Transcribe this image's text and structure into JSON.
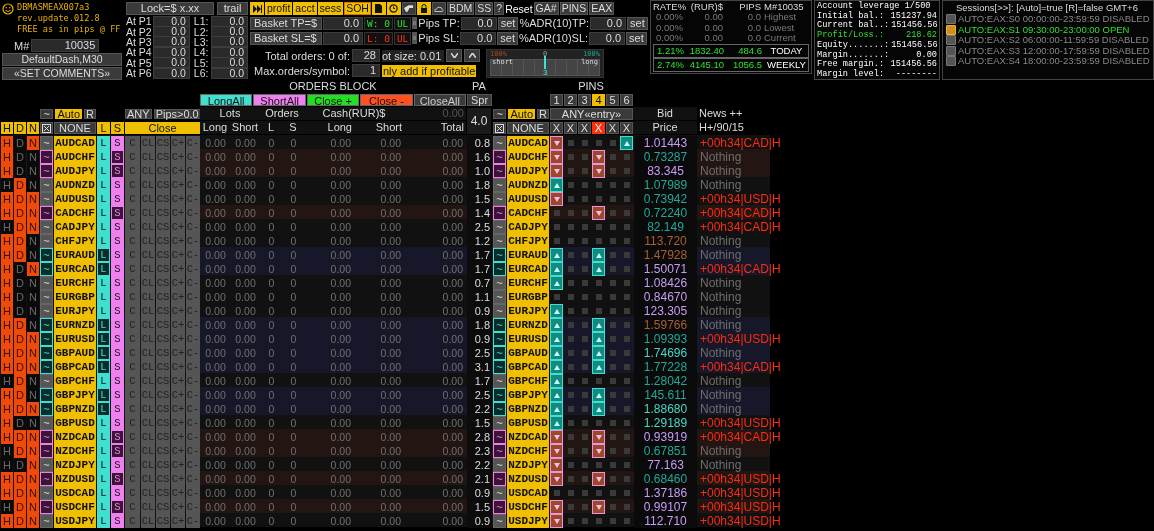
{
  "brand": {
    "title": "DBMASMEAX007a3",
    "version": "rev.update.012.8",
    "tagline": "FREE as in pips @ FF",
    "magic_label": "M#",
    "magic_value": "10035",
    "template_button": "DefaultDash,M30",
    "comments_button": "«SET COMMENTS»"
  },
  "lock": {
    "button": "Lock=$ x.xx",
    "trail": "trail",
    "profit_levels": [
      {
        "label": "At P1",
        "value": "0.0"
      },
      {
        "label": "At P2",
        "value": "0.0"
      },
      {
        "label": "At P3",
        "value": "0.0"
      },
      {
        "label": "At P4",
        "value": "0.0"
      },
      {
        "label": "At P5",
        "value": "0.0"
      },
      {
        "label": "At P6",
        "value": "0.0"
      }
    ],
    "loss_levels": [
      {
        "label": "L1:",
        "value": "0.0"
      },
      {
        "label": "L2:",
        "value": "0.0"
      },
      {
        "label": "L3:",
        "value": "0.0"
      },
      {
        "label": "L4:",
        "value": "0.0"
      },
      {
        "label": "L5:",
        "value": "0.0"
      },
      {
        "label": "L6:",
        "value": "0.0"
      }
    ]
  },
  "toolbar": {
    "primary": [
      "profit",
      "acct",
      "sess",
      "SOH"
    ],
    "secondary": [
      "BDM",
      "SS",
      "?"
    ],
    "reset": "Reset",
    "tertiary": [
      "GA#",
      "PINS",
      "EAX"
    ]
  },
  "basket": [
    {
      "label": "Basket TP=$",
      "value": "0.0",
      "counter": "W: 0",
      "counter_flag": "UL",
      "kind": "win",
      "pips_label": "Pips TP:",
      "pips_value": "0.0",
      "pips_button": "set",
      "adr_label": "%ADR(10)TP:",
      "adr_value": "0.0",
      "adr_button": "set"
    },
    {
      "label": "Basket SL=$",
      "value": "0.0",
      "counter": "L: 0",
      "counter_flag": "UL",
      "kind": "loss",
      "pips_label": "Pips SL:",
      "pips_value": "0.0",
      "pips_button": "set",
      "adr_label": "%ADR(10)SL:",
      "adr_value": "0.0",
      "adr_button": "set"
    }
  ],
  "orders": {
    "total_label": "Total orders: 0 of:",
    "total_value": "28",
    "lot_label": "ot size: 0.01",
    "max_label": "Max.orders/symbol:",
    "max_value": "1",
    "profitable_label": "nly add if profitable"
  },
  "slider": {
    "left_label": "100%",
    "center_label": "0",
    "right_label": "100%",
    "short_label": "short",
    "long_label": "long",
    "marker": "3",
    "level": 0.5
  },
  "stats": {
    "headers": [
      "RATE%",
      "(RUR)$",
      "PIPS",
      "M#10035"
    ],
    "rows": [
      {
        "rate": "0.00%",
        "cash": "0.00",
        "pips": "0.0",
        "label": "Highest",
        "active": false
      },
      {
        "rate": "0.00%",
        "cash": "0.00",
        "pips": "0.0",
        "label": "Lowest",
        "active": false
      },
      {
        "rate": "0.00%",
        "cash": "0.00",
        "pips": "0.0",
        "label": "Current",
        "active": false
      },
      {
        "rate": "1.21%",
        "cash": "1832.40",
        "pips": "484.6",
        "label": "TODAY",
        "active": true
      },
      {
        "rate": "2.74%",
        "cash": "4145.10",
        "pips": "1056.5",
        "label": "WEEKLY",
        "active": true
      }
    ]
  },
  "account": {
    "leverage": "Account leverage 1/500",
    "lines": [
      {
        "label": "Initial bal.:",
        "value": "151237.94",
        "positive": false
      },
      {
        "label": "Current bal..:",
        "value": "151456.56",
        "positive": false
      },
      {
        "label": "Profit/Loss.:",
        "value": "218.62",
        "positive": true
      },
      {
        "label": "Equity.......:",
        "value": "151456.56",
        "positive": false
      },
      {
        "label": "Margin.......:",
        "value": "0.00",
        "positive": false
      },
      {
        "label": "Free margin.:",
        "value": "151456.56",
        "positive": false
      },
      {
        "label": "Margin level:",
        "value": "--------",
        "positive": false
      }
    ]
  },
  "sessions": {
    "title": "Sessions[>>]: [Auto]=true [R]=false GMT+6",
    "items": [
      {
        "text": "AUTO:EAX:S0 00:00:00-23:59:59 DISABLED",
        "open": false
      },
      {
        "text": "AUTO:EAX:S1 09:30:00-23:00:00 OPEN",
        "open": true
      },
      {
        "text": "AUTO:EAX:S2 06:00:00-11:59:59 DISABLED",
        "open": false
      },
      {
        "text": "AUTO:EAX:S3 12:00:00-17:59:59 DISABLED",
        "open": false
      },
      {
        "text": "AUTO:EAX:S4 18:00:00-23:59:59 DISABLED",
        "open": false
      }
    ]
  },
  "table": {
    "orders_block_title": "ORDERS BLOCK",
    "pa_title": "PA",
    "pins_title": "PINS",
    "actions": [
      {
        "label": "LongAll",
        "kind": "long"
      },
      {
        "label": "ShortAll",
        "kind": "short"
      },
      {
        "label": "Close +",
        "kind": "profit"
      },
      {
        "label": "Close -",
        "kind": "loss"
      },
      {
        "label": "CloseAll",
        "kind": "all"
      }
    ],
    "spread_button": "Spr",
    "pa_value": "4.0",
    "left_controls": {
      "trend": "~",
      "auto": "Auto",
      "auto_on": true,
      "reset": "R"
    },
    "filter_any": "ANY",
    "filter_pips": "Pips>0.0",
    "col_lots": "Lots",
    "col_orders": "Orders",
    "col_cash": "Cash(RUR)$",
    "cash_total": "0.00",
    "right_controls": {
      "trend": "~",
      "auto": "Auto",
      "auto_on": true,
      "reset": "R"
    },
    "pins_entry": "ANY«entry»",
    "col_bid": "Bid",
    "col_news": "News ++",
    "flag_heads": [
      "H",
      "D",
      "N"
    ],
    "select_none": "NONE",
    "side_heads": [
      "L",
      "S"
    ],
    "close_head": "Close",
    "subheads": [
      "Long",
      "Short",
      "L",
      "S",
      "Long",
      "Short",
      "Total"
    ],
    "right_none": "NONE",
    "pin_tabs": [
      {
        "label": "1",
        "selected": false
      },
      {
        "label": "2",
        "selected": false
      },
      {
        "label": "3",
        "selected": false
      },
      {
        "label": "4",
        "selected": true
      },
      {
        "label": "5",
        "selected": false
      },
      {
        "label": "6",
        "selected": false
      }
    ],
    "pin_clear": [
      {
        "label": "X",
        "selected": false
      },
      {
        "label": "X",
        "selected": false
      },
      {
        "label": "X",
        "selected": false
      },
      {
        "label": "X",
        "selected": true
      },
      {
        "label": "X",
        "selected": false
      },
      {
        "label": "X",
        "selected": false
      }
    ],
    "col_price": "Price",
    "news_filter": "H+/90/15"
  },
  "rows": [
    {
      "flags": [
        {
          "label": "H",
          "on": true
        },
        {
          "label": "D",
          "on": false
        },
        {
          "label": "N",
          "on": true
        }
      ],
      "trend": "~",
      "kind": "flat",
      "symbol": "AUDCAD",
      "buttons": [
        "L",
        "S",
        "C",
        "CL",
        "CS",
        "C+",
        "C-"
      ],
      "values": [
        "0.00",
        "0.00",
        "0",
        "0",
        "0.00",
        "0.00",
        "0.00"
      ],
      "pa": "0.8",
      "trend_right": "~",
      "symbol_right": "AUDCAD",
      "pins": [
        {
          "kind": "down"
        },
        {
          "kind": "empty"
        },
        {
          "kind": "empty"
        },
        {
          "kind": "empty"
        },
        {
          "kind": "empty"
        },
        {
          "kind": "up"
        }
      ],
      "bid": "1.01443",
      "color": "#c89cf8",
      "news": "+00h34|CAD|H",
      "news_alert": true
    },
    {
      "flags": [
        {
          "label": "H",
          "on": true
        },
        {
          "label": "D",
          "on": false
        },
        {
          "label": "N",
          "on": false
        }
      ],
      "trend": "~",
      "kind": "short",
      "symbol": "AUDCHF",
      "buttons": [
        "L",
        "S",
        "C",
        "CL",
        "CS",
        "C+",
        "C-"
      ],
      "values": [
        "0.00",
        "0.00",
        "0",
        "0",
        "0.00",
        "0.00",
        "0.00"
      ],
      "pa": "1.6",
      "trend_right": "~",
      "symbol_right": "AUDCHF",
      "pins": [
        {
          "kind": "down"
        },
        {
          "kind": "empty"
        },
        {
          "kind": "empty"
        },
        {
          "kind": "down"
        },
        {
          "kind": "empty"
        },
        {
          "kind": "empty"
        }
      ],
      "bid": "0.73287",
      "color": "#22a89a",
      "news": "Nothing",
      "news_alert": false
    },
    {
      "flags": [
        {
          "label": "H",
          "on": true
        },
        {
          "label": "D",
          "on": false
        },
        {
          "label": "N",
          "on": false
        }
      ],
      "trend": "~",
      "kind": "short",
      "symbol": "AUDJPY",
      "buttons": [
        "L",
        "S",
        "C",
        "CL",
        "CS",
        "C+",
        "C-"
      ],
      "values": [
        "0.00",
        "0.00",
        "0",
        "0",
        "0.00",
        "0.00",
        "0.00"
      ],
      "pa": "1.0",
      "trend_right": "~",
      "symbol_right": "AUDJPY",
      "pins": [
        {
          "kind": "down"
        },
        {
          "kind": "empty"
        },
        {
          "kind": "empty"
        },
        {
          "kind": "down"
        },
        {
          "kind": "empty"
        },
        {
          "kind": "empty"
        }
      ],
      "bid": "83.345",
      "color": "#c89cf8",
      "news": "Nothing",
      "news_alert": false
    },
    {
      "flags": [
        {
          "label": "H",
          "on": false
        },
        {
          "label": "D",
          "on": true
        },
        {
          "label": "N",
          "on": false
        }
      ],
      "trend": "~",
      "kind": "flat",
      "symbol": "AUDNZD",
      "buttons": [
        "L",
        "S",
        "C",
        "CL",
        "CS",
        "C+",
        "C-"
      ],
      "values": [
        "0.00",
        "0.00",
        "0",
        "0",
        "0.00",
        "0.00",
        "0.00"
      ],
      "pa": "1.8",
      "trend_right": "~",
      "symbol_right": "AUDNZD",
      "pins": [
        {
          "kind": "up"
        },
        {
          "kind": "empty"
        },
        {
          "kind": "empty"
        },
        {
          "kind": "empty"
        },
        {
          "kind": "empty"
        },
        {
          "kind": "empty"
        }
      ],
      "bid": "1.07989",
      "color": "#22a89a",
      "news": "Nothing",
      "news_alert": false
    },
    {
      "flags": [
        {
          "label": "H",
          "on": true
        },
        {
          "label": "D",
          "on": true
        },
        {
          "label": "N",
          "on": true
        }
      ],
      "trend": "~",
      "kind": "flat",
      "symbol": "AUDUSD",
      "buttons": [
        "L",
        "S",
        "C",
        "CL",
        "CS",
        "C+",
        "C-"
      ],
      "values": [
        "0.00",
        "0.00",
        "0",
        "0",
        "0.00",
        "0.00",
        "0.00"
      ],
      "pa": "1.5",
      "trend_right": "~",
      "symbol_right": "AUDUSD",
      "pins": [
        {
          "kind": "down"
        },
        {
          "kind": "empty"
        },
        {
          "kind": "empty"
        },
        {
          "kind": "empty"
        },
        {
          "kind": "empty"
        },
        {
          "kind": "empty"
        }
      ],
      "bid": "0.73942",
      "color": "#22a89a",
      "news": "+00h34|USD|H",
      "news_alert": true
    },
    {
      "flags": [
        {
          "label": "H",
          "on": true
        },
        {
          "label": "D",
          "on": true
        },
        {
          "label": "N",
          "on": true
        }
      ],
      "trend": "~",
      "kind": "short",
      "symbol": "CADCHF",
      "buttons": [
        "L",
        "S",
        "C",
        "CL",
        "CS",
        "C+",
        "C-"
      ],
      "values": [
        "0.00",
        "0.00",
        "0",
        "0",
        "0.00",
        "0.00",
        "0.00"
      ],
      "pa": "1.4",
      "trend_right": "~",
      "symbol_right": "CADCHF",
      "pins": [
        {
          "kind": "empty"
        },
        {
          "kind": "empty"
        },
        {
          "kind": "empty"
        },
        {
          "kind": "down"
        },
        {
          "kind": "empty"
        },
        {
          "kind": "empty"
        }
      ],
      "bid": "0.72240",
      "color": "#22a89a",
      "news": "+00h34|CAD|H",
      "news_alert": true
    },
    {
      "flags": [
        {
          "label": "H",
          "on": false
        },
        {
          "label": "D",
          "on": true
        },
        {
          "label": "N",
          "on": true
        }
      ],
      "trend": "~",
      "kind": "flat",
      "symbol": "CADJPY",
      "buttons": [
        "L",
        "S",
        "C",
        "CL",
        "CS",
        "C+",
        "C-"
      ],
      "values": [
        "0.00",
        "0.00",
        "0",
        "0",
        "0.00",
        "0.00",
        "0.00"
      ],
      "pa": "2.5",
      "trend_right": "~",
      "symbol_right": "CADJPY",
      "pins": [
        {
          "kind": "empty"
        },
        {
          "kind": "empty"
        },
        {
          "kind": "empty"
        },
        {
          "kind": "empty"
        },
        {
          "kind": "empty"
        },
        {
          "kind": "empty"
        }
      ],
      "bid": "82.149",
      "color": "#22a89a",
      "news": "+00h34|CAD|H",
      "news_alert": true
    },
    {
      "flags": [
        {
          "label": "H",
          "on": true
        },
        {
          "label": "D",
          "on": true
        },
        {
          "label": "N",
          "on": false
        }
      ],
      "trend": "~",
      "kind": "flat",
      "symbol": "CHFJPY",
      "buttons": [
        "L",
        "S",
        "C",
        "CL",
        "CS",
        "C+",
        "C-"
      ],
      "values": [
        "0.00",
        "0.00",
        "0",
        "0",
        "0.00",
        "0.00",
        "0.00"
      ],
      "pa": "1.2",
      "trend_right": "~",
      "symbol_right": "CHFJPY",
      "pins": [
        {
          "kind": "empty"
        },
        {
          "kind": "empty"
        },
        {
          "kind": "empty"
        },
        {
          "kind": "empty"
        },
        {
          "kind": "empty"
        },
        {
          "kind": "empty"
        }
      ],
      "bid": "113.720",
      "color": "#a86030",
      "news": "Nothing",
      "news_alert": false
    },
    {
      "flags": [
        {
          "label": "H",
          "on": true
        },
        {
          "label": "D",
          "on": true
        },
        {
          "label": "N",
          "on": false
        }
      ],
      "trend": "~",
      "kind": "long",
      "symbol": "EURAUD",
      "buttons": [
        "L",
        "S",
        "C",
        "CL",
        "CS",
        "C+",
        "C-"
      ],
      "values": [
        "0.00",
        "0.00",
        "0",
        "0",
        "0.00",
        "0.00",
        "0.00"
      ],
      "pa": "1.7",
      "trend_right": "~",
      "symbol_right": "EURAUD",
      "pins": [
        {
          "kind": "up"
        },
        {
          "kind": "empty"
        },
        {
          "kind": "empty"
        },
        {
          "kind": "up"
        },
        {
          "kind": "empty"
        },
        {
          "kind": "empty"
        }
      ],
      "bid": "1.47928",
      "color": "#a86030",
      "news": "Nothing",
      "news_alert": false
    },
    {
      "flags": [
        {
          "label": "H",
          "on": true
        },
        {
          "label": "D",
          "on": false
        },
        {
          "label": "N",
          "on": true
        }
      ],
      "trend": "~",
      "kind": "long",
      "symbol": "EURCAD",
      "buttons": [
        "L",
        "S",
        "C",
        "CL",
        "CS",
        "C+",
        "C-"
      ],
      "values": [
        "0.00",
        "0.00",
        "0",
        "0",
        "0.00",
        "0.00",
        "0.00"
      ],
      "pa": "1.7",
      "trend_right": "~",
      "symbol_right": "EURCAD",
      "pins": [
        {
          "kind": "up"
        },
        {
          "kind": "empty"
        },
        {
          "kind": "empty"
        },
        {
          "kind": "up"
        },
        {
          "kind": "empty"
        },
        {
          "kind": "empty"
        }
      ],
      "bid": "1.50071",
      "color": "#c89cf8",
      "news": "+00h34|CAD|H",
      "news_alert": true
    },
    {
      "flags": [
        {
          "label": "H",
          "on": true
        },
        {
          "label": "D",
          "on": false
        },
        {
          "label": "N",
          "on": false
        }
      ],
      "trend": "~",
      "kind": "flat",
      "symbol": "EURCHF",
      "buttons": [
        "L",
        "S",
        "C",
        "CL",
        "CS",
        "C+",
        "C-"
      ],
      "values": [
        "0.00",
        "0.00",
        "0",
        "0",
        "0.00",
        "0.00",
        "0.00"
      ],
      "pa": "0.7",
      "trend_right": "~",
      "symbol_right": "EURCHF",
      "pins": [
        {
          "kind": "up"
        },
        {
          "kind": "empty"
        },
        {
          "kind": "empty"
        },
        {
          "kind": "empty"
        },
        {
          "kind": "empty"
        },
        {
          "kind": "empty"
        }
      ],
      "bid": "1.08426",
      "color": "#c89cf8",
      "news": "Nothing",
      "news_alert": false
    },
    {
      "flags": [
        {
          "label": "H",
          "on": true
        },
        {
          "label": "D",
          "on": false
        },
        {
          "label": "N",
          "on": false
        }
      ],
      "trend": "~",
      "kind": "flat",
      "symbol": "EURGBP",
      "buttons": [
        "L",
        "S",
        "C",
        "CL",
        "CS",
        "C+",
        "C-"
      ],
      "values": [
        "0.00",
        "0.00",
        "0",
        "0",
        "0.00",
        "0.00",
        "0.00"
      ],
      "pa": "1.1",
      "trend_right": "~",
      "symbol_right": "EURGBP",
      "pins": [
        {
          "kind": "empty"
        },
        {
          "kind": "empty"
        },
        {
          "kind": "empty"
        },
        {
          "kind": "empty"
        },
        {
          "kind": "empty"
        },
        {
          "kind": "empty"
        }
      ],
      "bid": "0.84670",
      "color": "#c89cf8",
      "news": "Nothing",
      "news_alert": false
    },
    {
      "flags": [
        {
          "label": "H",
          "on": true
        },
        {
          "label": "D",
          "on": false
        },
        {
          "label": "N",
          "on": false
        }
      ],
      "trend": "~",
      "kind": "flat",
      "symbol": "EURJPY",
      "buttons": [
        "L",
        "S",
        "C",
        "CL",
        "CS",
        "C+",
        "C-"
      ],
      "values": [
        "0.00",
        "0.00",
        "0",
        "0",
        "0.00",
        "0.00",
        "0.00"
      ],
      "pa": "0.9",
      "trend_right": "~",
      "symbol_right": "EURJPY",
      "pins": [
        {
          "kind": "up"
        },
        {
          "kind": "empty"
        },
        {
          "kind": "empty"
        },
        {
          "kind": "empty"
        },
        {
          "kind": "empty"
        },
        {
          "kind": "empty"
        }
      ],
      "bid": "123.305",
      "color": "#c89cf8",
      "news": "Nothing",
      "news_alert": false
    },
    {
      "flags": [
        {
          "label": "H",
          "on": true
        },
        {
          "label": "D",
          "on": true
        },
        {
          "label": "N",
          "on": false
        }
      ],
      "trend": "~",
      "kind": "long",
      "symbol": "EURNZD",
      "buttons": [
        "L",
        "S",
        "C",
        "CL",
        "CS",
        "C+",
        "C-"
      ],
      "values": [
        "0.00",
        "0.00",
        "0",
        "0",
        "0.00",
        "0.00",
        "0.00"
      ],
      "pa": "1.8",
      "trend_right": "~",
      "symbol_right": "EURNZD",
      "pins": [
        {
          "kind": "up"
        },
        {
          "kind": "empty"
        },
        {
          "kind": "empty"
        },
        {
          "kind": "up"
        },
        {
          "kind": "empty"
        },
        {
          "kind": "empty"
        }
      ],
      "bid": "1.59766",
      "color": "#a86030",
      "news": "Nothing",
      "news_alert": false
    },
    {
      "flags": [
        {
          "label": "H",
          "on": true
        },
        {
          "label": "D",
          "on": true
        },
        {
          "label": "N",
          "on": true
        }
      ],
      "trend": "~",
      "kind": "long",
      "symbol": "EURUSD",
      "buttons": [
        "L",
        "S",
        "C",
        "CL",
        "CS",
        "C+",
        "C-"
      ],
      "values": [
        "0.00",
        "0.00",
        "0",
        "0",
        "0.00",
        "0.00",
        "0.00"
      ],
      "pa": "0.9",
      "trend_right": "~",
      "symbol_right": "EURUSD",
      "pins": [
        {
          "kind": "up"
        },
        {
          "kind": "empty"
        },
        {
          "kind": "empty"
        },
        {
          "kind": "up"
        },
        {
          "kind": "empty"
        },
        {
          "kind": "empty"
        }
      ],
      "bid": "1.09393",
      "color": "#22a89a",
      "news": "+00h34|USD|H",
      "news_alert": true
    },
    {
      "flags": [
        {
          "label": "H",
          "on": true
        },
        {
          "label": "D",
          "on": true
        },
        {
          "label": "N",
          "on": true
        }
      ],
      "trend": "~",
      "kind": "long",
      "symbol": "GBPAUD",
      "buttons": [
        "L",
        "S",
        "C",
        "CL",
        "CS",
        "C+",
        "C-"
      ],
      "values": [
        "0.00",
        "0.00",
        "0",
        "0",
        "0.00",
        "0.00",
        "0.00"
      ],
      "pa": "2.5",
      "trend_right": "~",
      "symbol_right": "GBPAUD",
      "pins": [
        {
          "kind": "up"
        },
        {
          "kind": "empty"
        },
        {
          "kind": "empty"
        },
        {
          "kind": "up"
        },
        {
          "kind": "empty"
        },
        {
          "kind": "empty"
        }
      ],
      "bid": "1.74696",
      "color": "#48d8c8",
      "news": "Nothing",
      "news_alert": false
    },
    {
      "flags": [
        {
          "label": "H",
          "on": true
        },
        {
          "label": "D",
          "on": true
        },
        {
          "label": "N",
          "on": true
        }
      ],
      "trend": "~",
      "kind": "long",
      "symbol": "GBPCAD",
      "buttons": [
        "L",
        "S",
        "C",
        "CL",
        "CS",
        "C+",
        "C-"
      ],
      "values": [
        "0.00",
        "0.00",
        "0",
        "0",
        "0.00",
        "0.00",
        "0.00"
      ],
      "pa": "3.1",
      "trend_right": "~",
      "symbol_right": "GBPCAD",
      "pins": [
        {
          "kind": "up"
        },
        {
          "kind": "empty"
        },
        {
          "kind": "empty"
        },
        {
          "kind": "up"
        },
        {
          "kind": "empty"
        },
        {
          "kind": "empty"
        }
      ],
      "bid": "1.77228",
      "color": "#22a89a",
      "news": "+00h34|CAD|H",
      "news_alert": true
    },
    {
      "flags": [
        {
          "label": "H",
          "on": false
        },
        {
          "label": "D",
          "on": true
        },
        {
          "label": "N",
          "on": false
        }
      ],
      "trend": "~",
      "kind": "flat",
      "symbol": "GBPCHF",
      "buttons": [
        "L",
        "S",
        "C",
        "CL",
        "CS",
        "C+",
        "C-"
      ],
      "values": [
        "0.00",
        "0.00",
        "0",
        "0",
        "0.00",
        "0.00",
        "0.00"
      ],
      "pa": "1.7",
      "trend_right": "~",
      "symbol_right": "GBPCHF",
      "pins": [
        {
          "kind": "up"
        },
        {
          "kind": "empty"
        },
        {
          "kind": "empty"
        },
        {
          "kind": "empty"
        },
        {
          "kind": "empty"
        },
        {
          "kind": "empty"
        }
      ],
      "bid": "1.28042",
      "color": "#22a89a",
      "news": "Nothing",
      "news_alert": false
    },
    {
      "flags": [
        {
          "label": "H",
          "on": true
        },
        {
          "label": "D",
          "on": true
        },
        {
          "label": "N",
          "on": false
        }
      ],
      "trend": "~",
      "kind": "long",
      "symbol": "GBPJPY",
      "buttons": [
        "L",
        "S",
        "C",
        "CL",
        "CS",
        "C+",
        "C-"
      ],
      "values": [
        "0.00",
        "0.00",
        "0",
        "0",
        "0.00",
        "0.00",
        "0.00"
      ],
      "pa": "2.5",
      "trend_right": "~",
      "symbol_right": "GBPJPY",
      "pins": [
        {
          "kind": "up"
        },
        {
          "kind": "empty"
        },
        {
          "kind": "empty"
        },
        {
          "kind": "up"
        },
        {
          "kind": "empty"
        },
        {
          "kind": "empty"
        }
      ],
      "bid": "145.611",
      "color": "#22a89a",
      "news": "Nothing",
      "news_alert": false
    },
    {
      "flags": [
        {
          "label": "H",
          "on": true
        },
        {
          "label": "D",
          "on": true
        },
        {
          "label": "N",
          "on": true
        }
      ],
      "trend": "~",
      "kind": "long",
      "symbol": "GBPNZD",
      "buttons": [
        "L",
        "S",
        "C",
        "CL",
        "CS",
        "C+",
        "C-"
      ],
      "values": [
        "0.00",
        "0.00",
        "0",
        "0",
        "0.00",
        "0.00",
        "0.00"
      ],
      "pa": "2.2",
      "trend_right": "~",
      "symbol_right": "GBPNZD",
      "pins": [
        {
          "kind": "up"
        },
        {
          "kind": "empty"
        },
        {
          "kind": "empty"
        },
        {
          "kind": "up"
        },
        {
          "kind": "empty"
        },
        {
          "kind": "empty"
        }
      ],
      "bid": "1.88680",
      "color": "#48d8c8",
      "news": "Nothing",
      "news_alert": false
    },
    {
      "flags": [
        {
          "label": "H",
          "on": true
        },
        {
          "label": "D",
          "on": false
        },
        {
          "label": "N",
          "on": false
        }
      ],
      "trend": "~",
      "kind": "flat",
      "symbol": "GBPUSD",
      "buttons": [
        "L",
        "S",
        "C",
        "CL",
        "CS",
        "C+",
        "C-"
      ],
      "values": [
        "0.00",
        "0.00",
        "0",
        "0",
        "0.00",
        "0.00",
        "0.00"
      ],
      "pa": "1.5",
      "trend_right": "~",
      "symbol_right": "GBPUSD",
      "pins": [
        {
          "kind": "up"
        },
        {
          "kind": "empty"
        },
        {
          "kind": "empty"
        },
        {
          "kind": "empty"
        },
        {
          "kind": "empty"
        },
        {
          "kind": "empty"
        }
      ],
      "bid": "1.29189",
      "color": "#48d8c8",
      "news": "+00h34|USD|H",
      "news_alert": true
    },
    {
      "flags": [
        {
          "label": "H",
          "on": true
        },
        {
          "label": "D",
          "on": true
        },
        {
          "label": "N",
          "on": true
        }
      ],
      "trend": "~",
      "kind": "short",
      "symbol": "NZDCAD",
      "buttons": [
        "L",
        "S",
        "C",
        "CL",
        "CS",
        "C+",
        "C-"
      ],
      "values": [
        "0.00",
        "0.00",
        "0",
        "0",
        "0.00",
        "0.00",
        "0.00"
      ],
      "pa": "2.8",
      "trend_right": "~",
      "symbol_right": "NZDCAD",
      "pins": [
        {
          "kind": "down"
        },
        {
          "kind": "empty"
        },
        {
          "kind": "empty"
        },
        {
          "kind": "down"
        },
        {
          "kind": "empty"
        },
        {
          "kind": "empty"
        }
      ],
      "bid": "0.93919",
      "color": "#c89cf8",
      "news": "+00h34|CAD|H",
      "news_alert": true
    },
    {
      "flags": [
        {
          "label": "H",
          "on": false
        },
        {
          "label": "D",
          "on": true
        },
        {
          "label": "N",
          "on": true
        }
      ],
      "trend": "~",
      "kind": "short",
      "symbol": "NZDCHF",
      "buttons": [
        "L",
        "S",
        "C",
        "CL",
        "CS",
        "C+",
        "C-"
      ],
      "values": [
        "0.00",
        "0.00",
        "0",
        "0",
        "0.00",
        "0.00",
        "0.00"
      ],
      "pa": "2.3",
      "trend_right": "~",
      "symbol_right": "NZDCHF",
      "pins": [
        {
          "kind": "down"
        },
        {
          "kind": "empty"
        },
        {
          "kind": "empty"
        },
        {
          "kind": "down"
        },
        {
          "kind": "empty"
        },
        {
          "kind": "empty"
        }
      ],
      "bid": "0.67851",
      "color": "#22a89a",
      "news": "Nothing",
      "news_alert": false
    },
    {
      "flags": [
        {
          "label": "H",
          "on": false
        },
        {
          "label": "D",
          "on": false
        },
        {
          "label": "N",
          "on": true
        }
      ],
      "trend": "~",
      "kind": "flat",
      "symbol": "NZDJPY",
      "buttons": [
        "L",
        "S",
        "C",
        "CL",
        "CS",
        "C+",
        "C-"
      ],
      "values": [
        "0.00",
        "0.00",
        "0",
        "0",
        "0.00",
        "0.00",
        "0.00"
      ],
      "pa": "2.2",
      "trend_right": "~",
      "symbol_right": "NZDJPY",
      "pins": [
        {
          "kind": "down"
        },
        {
          "kind": "empty"
        },
        {
          "kind": "empty"
        },
        {
          "kind": "empty"
        },
        {
          "kind": "empty"
        },
        {
          "kind": "empty"
        }
      ],
      "bid": "77.163",
      "color": "#c89cf8",
      "news": "Nothing",
      "news_alert": false
    },
    {
      "flags": [
        {
          "label": "H",
          "on": true
        },
        {
          "label": "D",
          "on": true
        },
        {
          "label": "N",
          "on": true
        }
      ],
      "trend": "~",
      "kind": "short",
      "symbol": "NZDUSD",
      "buttons": [
        "L",
        "S",
        "C",
        "CL",
        "CS",
        "C+",
        "C-"
      ],
      "values": [
        "0.00",
        "0.00",
        "0",
        "0",
        "0.00",
        "0.00",
        "0.00"
      ],
      "pa": "2.1",
      "trend_right": "~",
      "symbol_right": "NZDUSD",
      "pins": [
        {
          "kind": "down"
        },
        {
          "kind": "empty"
        },
        {
          "kind": "empty"
        },
        {
          "kind": "down"
        },
        {
          "kind": "empty"
        },
        {
          "kind": "empty"
        }
      ],
      "bid": "0.68460",
      "color": "#22a89a",
      "news": "+00h34|USD|H",
      "news_alert": true
    },
    {
      "flags": [
        {
          "label": "H",
          "on": true
        },
        {
          "label": "D",
          "on": true
        },
        {
          "label": "N",
          "on": true
        }
      ],
      "trend": "~",
      "kind": "flat",
      "symbol": "USDCAD",
      "buttons": [
        "L",
        "S",
        "C",
        "CL",
        "CS",
        "C+",
        "C-"
      ],
      "values": [
        "0.00",
        "0.00",
        "0",
        "0",
        "0.00",
        "0.00",
        "0.00"
      ],
      "pa": "0.9",
      "trend_right": "~",
      "symbol_right": "USDCAD",
      "pins": [
        {
          "kind": "empty"
        },
        {
          "kind": "empty"
        },
        {
          "kind": "empty"
        },
        {
          "kind": "empty"
        },
        {
          "kind": "empty"
        },
        {
          "kind": "empty"
        }
      ],
      "bid": "1.37186",
      "color": "#c89cf8",
      "news": "+00h34|USD|H",
      "news_alert": true
    },
    {
      "flags": [
        {
          "label": "H",
          "on": false
        },
        {
          "label": "D",
          "on": true
        },
        {
          "label": "N",
          "on": true
        }
      ],
      "trend": "~",
      "kind": "short",
      "symbol": "USDCHF",
      "buttons": [
        "L",
        "S",
        "C",
        "CL",
        "CS",
        "C+",
        "C-"
      ],
      "values": [
        "0.00",
        "0.00",
        "0",
        "0",
        "0.00",
        "0.00",
        "0.00"
      ],
      "pa": "1.5",
      "trend_right": "~",
      "symbol_right": "USDCHF",
      "pins": [
        {
          "kind": "down"
        },
        {
          "kind": "empty"
        },
        {
          "kind": "empty"
        },
        {
          "kind": "down"
        },
        {
          "kind": "empty"
        },
        {
          "kind": "empty"
        }
      ],
      "bid": "0.99107",
      "color": "#c89cf8",
      "news": "+00h34|USD|H",
      "news_alert": true
    },
    {
      "flags": [
        {
          "label": "H",
          "on": true
        },
        {
          "label": "D",
          "on": true
        },
        {
          "label": "N",
          "on": true
        }
      ],
      "trend": "~",
      "kind": "flat",
      "symbol": "USDJPY",
      "buttons": [
        "L",
        "S",
        "C",
        "CL",
        "CS",
        "C+",
        "C-"
      ],
      "values": [
        "0.00",
        "0.00",
        "0",
        "0",
        "0.00",
        "0.00",
        "0.00"
      ],
      "pa": "0.9",
      "trend_right": "~",
      "symbol_right": "USDJPY",
      "pins": [
        {
          "kind": "down"
        },
        {
          "kind": "empty"
        },
        {
          "kind": "empty"
        },
        {
          "kind": "empty"
        },
        {
          "kind": "empty"
        },
        {
          "kind": "empty"
        }
      ],
      "bid": "112.710",
      "color": "#c89cf8",
      "news": "+00h34|USD|H",
      "news_alert": true
    }
  ]
}
